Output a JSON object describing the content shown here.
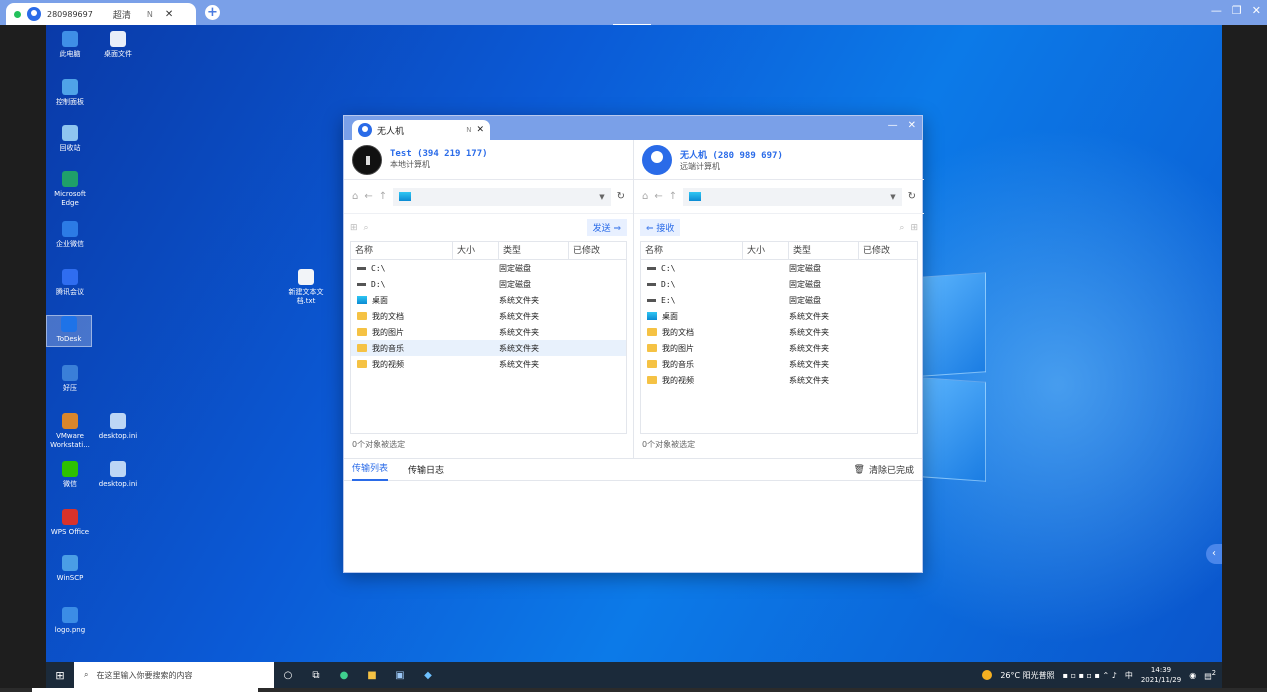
{
  "top_tab": {
    "remote_id": "280989697",
    "quality": "超清",
    "mode": "N"
  },
  "desktop_icons": [
    {
      "label": "此电脑",
      "name": "desktop-icon-this-pc",
      "color": "#3f8fe6"
    },
    {
      "label": "桌面文件",
      "name": "desktop-icon-desktop-files",
      "color": "#e8eef8"
    },
    {
      "label": "控制面板",
      "name": "desktop-icon-control-panel",
      "color": "#4fa3e8"
    },
    {
      "label": "回收站",
      "name": "desktop-icon-recycle-bin",
      "color": "#8ec5f0"
    },
    {
      "label": "Microsoft Edge",
      "name": "desktop-icon-edge",
      "color": "#1fa06a"
    },
    {
      "label": "企业微信",
      "name": "desktop-icon-wecom",
      "color": "#2c7be5"
    },
    {
      "label": "腾讯会议",
      "name": "desktop-icon-tencent-meeting",
      "color": "#2f6df0"
    },
    {
      "label": "ToDesk",
      "name": "desktop-icon-todesk",
      "color": "#1e73e8"
    },
    {
      "label": "好压",
      "name": "desktop-icon-haozip",
      "color": "#3a7fd8"
    },
    {
      "label": "VMware Workstati...",
      "name": "desktop-icon-vmware",
      "color": "#d9862b"
    },
    {
      "label": "desktop.ini",
      "name": "desktop-icon-desktop-ini-1",
      "color": "#bcd6f5"
    },
    {
      "label": "微信",
      "name": "desktop-icon-wechat",
      "color": "#2dc100"
    },
    {
      "label": "desktop.ini",
      "name": "desktop-icon-desktop-ini-2",
      "color": "#bcd6f5"
    },
    {
      "label": "WPS Office",
      "name": "desktop-icon-wps",
      "color": "#d8322b"
    },
    {
      "label": "WinSCP",
      "name": "desktop-icon-winscp",
      "color": "#4a9ee6"
    },
    {
      "label": "logo.png",
      "name": "desktop-icon-logo-png",
      "color": "#3b8de6"
    },
    {
      "label": "新建文本文档.txt",
      "name": "desktop-icon-new-text-doc",
      "color": "#f2f4f8"
    }
  ],
  "ft": {
    "title": "无人机",
    "mode": "N",
    "local": {
      "name": "Test (394 219 177)",
      "sub": "本地计算机",
      "send": "发送"
    },
    "remote": {
      "name": "无人机 (280 989 697)",
      "sub": "远端计算机",
      "receive": "接收"
    },
    "columns": [
      "名称",
      "大小",
      "类型",
      "已修改"
    ],
    "local_rows": [
      {
        "name": "C:\\",
        "type": "固定磁盘",
        "icon": "drive"
      },
      {
        "name": "D:\\",
        "type": "固定磁盘",
        "icon": "drive"
      },
      {
        "name": "桌面",
        "type": "系统文件夹",
        "icon": "desktop"
      },
      {
        "name": "我的文档",
        "type": "系统文件夹",
        "icon": "folder"
      },
      {
        "name": "我的图片",
        "type": "系统文件夹",
        "icon": "folder"
      },
      {
        "name": "我的音乐",
        "type": "系统文件夹",
        "icon": "folder"
      },
      {
        "name": "我的视频",
        "type": "系统文件夹",
        "icon": "folder"
      }
    ],
    "remote_rows": [
      {
        "name": "C:\\",
        "type": "固定磁盘",
        "icon": "drive"
      },
      {
        "name": "D:\\",
        "type": "固定磁盘",
        "icon": "drive"
      },
      {
        "name": "E:\\",
        "type": "固定磁盘",
        "icon": "drive"
      },
      {
        "name": "桌面",
        "type": "系统文件夹",
        "icon": "desktop"
      },
      {
        "name": "我的文档",
        "type": "系统文件夹",
        "icon": "folder"
      },
      {
        "name": "我的图片",
        "type": "系统文件夹",
        "icon": "folder"
      },
      {
        "name": "我的音乐",
        "type": "系统文件夹",
        "icon": "folder"
      },
      {
        "name": "我的视频",
        "type": "系统文件夹",
        "icon": "folder"
      }
    ],
    "local_status": "0个对象被选定",
    "remote_status": "0个对象被选定",
    "tab_transfer": "传输列表",
    "tab_log": "传输日志",
    "clear_done": "清除已完成"
  },
  "taskbar": {
    "search_placeholder": "在这里输入你要搜索的内容",
    "weather": "26°C 阳光普照",
    "ime": "中",
    "time": "14:39",
    "date": "2021/11/29",
    "notif_count": "2"
  }
}
